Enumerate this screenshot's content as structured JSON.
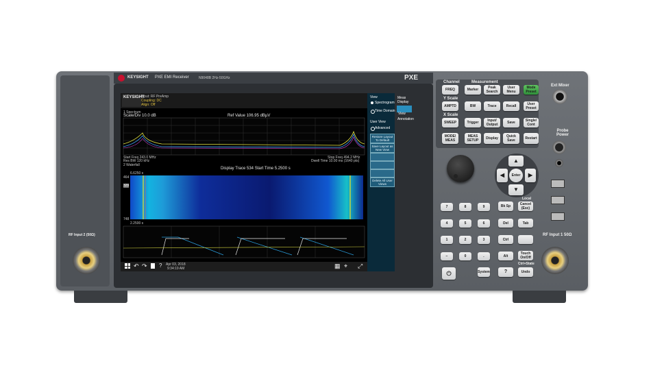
{
  "brand": {
    "name": "KEYSIGHT",
    "product": "PXE EMI Receiver",
    "model": "N9048B 2Hz-50GHz",
    "series": "PXE"
  },
  "screen": {
    "mode_badge": "KEYSIGHT",
    "header_lines": [
      "Input: RF  PreAmp",
      "Coupling: DC",
      "Align: Off"
    ],
    "view_label": "1 Spectrum",
    "scale": "Scale/Div 10.0 dB",
    "ref_value": "Ref Value 106.95 dBµV",
    "start_freq": "Start Freq 243.0 MHz",
    "stop_freq": "Stop Freq 494.2 MHz",
    "res_bw": "Res BW 120 kHz",
    "dwell": "Dwell Time 10.00 ms (1640 pts)",
    "view2_label": "2 Waterfall",
    "display_trace": "Display Trace 534   Start Time 5.2500 s",
    "time_top": "6.6250 s",
    "time_bottom": "2.2500 s",
    "marker_464": "464",
    "marker_329": "329",
    "marker_748": "748",
    "taskbar_date": "Apr 03, 2018",
    "taskbar_time": "9:34:19 AM"
  },
  "softkeys": {
    "header": "View",
    "items": [
      "Spectrogram",
      "Time Domain",
      "User View",
      "Advanced",
      "Restore Layout To Default",
      "Save Layout as New View",
      "Delete All User Views"
    ],
    "side": [
      "Meas Display",
      "View",
      "Annotation"
    ]
  },
  "front_panel": {
    "groups": {
      "channel": "Channel",
      "measurement": "Measurement",
      "y_scale": "Y Scale",
      "x_scale": "X Scale",
      "local": "Local",
      "ctrl_state": "Ctrl+State",
      "ext_mixer": "Ext Mixer",
      "probe_power": "Probe Power"
    },
    "keys": {
      "freq": "FREQ",
      "marker": "Marker",
      "peak_search": "Peak\nSearch",
      "user_menu": "User\nMenu",
      "mode_preset": "Mode\nPreset",
      "amptd": "AMPTD",
      "bw": "BW",
      "trace": "Trace",
      "recall": "Recall",
      "user_preset": "User\nPreset",
      "sweep": "SWEEP",
      "trigger": "Trigger",
      "input_output": "Input/\nOutput",
      "save": "Save",
      "single_cont": "Single/\nCont",
      "mode_meas": "MODE/\nMEAS",
      "meas_setup": "MEAS\nSETUP",
      "display": "Display",
      "quick_save": "Quick\nSave",
      "restart": "Restart",
      "enter": "Enter",
      "bk_sp": "Bk Sp",
      "cancel_esc": "Cancel\n(Esc)",
      "del": "Del",
      "tab": "Tab",
      "ctrl": "Ctrl",
      "alt": "Alt",
      "system": "System",
      "touch_onoff": "Touch\nOn/Off",
      "undo": "Undo",
      "help": "?"
    },
    "digits": [
      "7",
      "8",
      "9",
      "4",
      "5",
      "6",
      "1",
      "2",
      "3",
      "0",
      "."
    ],
    "rf_input_1": "RF Input 1 50Ω",
    "rf_input_2": "RF Input 2 (50Ω)"
  },
  "colors": {
    "accent": "#2a8fbf",
    "green_key": "#3fa84a",
    "chassis": "#5d6166",
    "brand_red": "#c8102e"
  },
  "chart_data": {
    "type": "line",
    "title": "",
    "xlabel": "",
    "ylabel": "",
    "x_range_mhz": [
      243.0,
      494.2
    ],
    "series": [
      {
        "values_description": ""
      }
    ]
  }
}
